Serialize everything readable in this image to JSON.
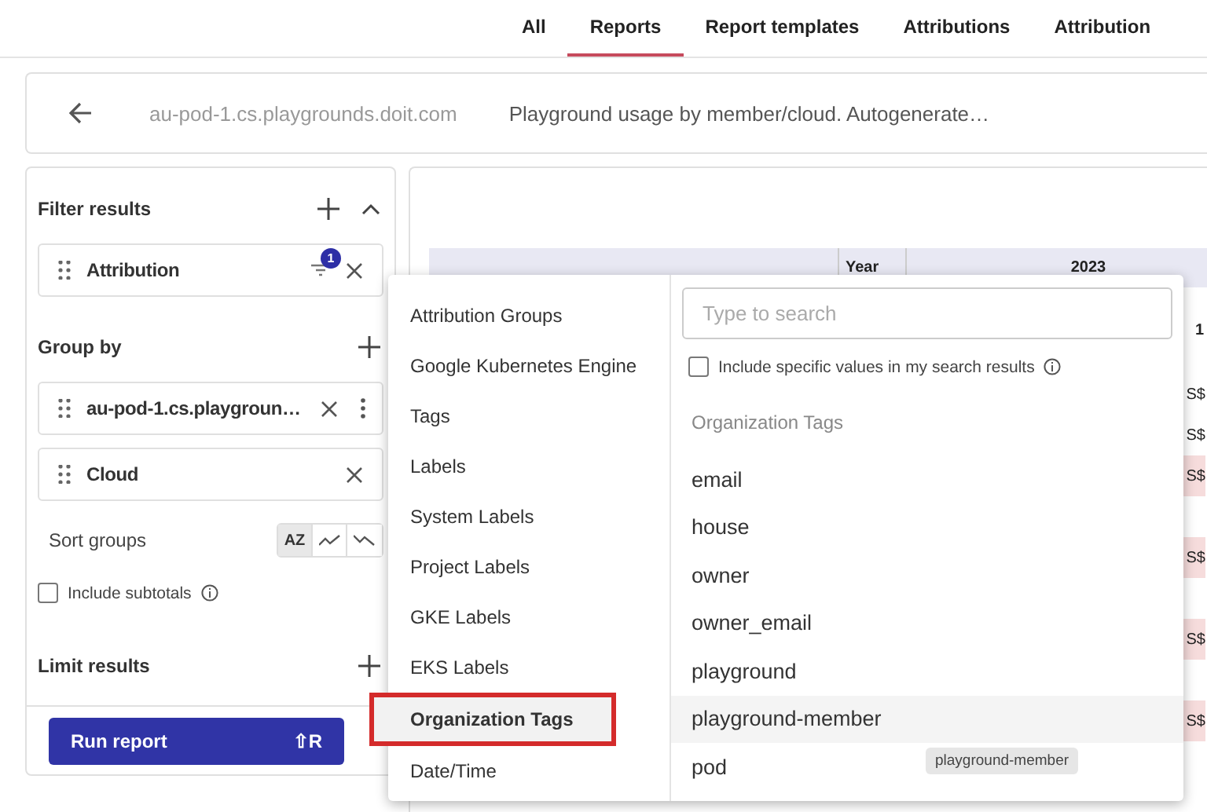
{
  "tabs": [
    {
      "label": "All",
      "selected": false
    },
    {
      "label": "Reports",
      "selected": true
    },
    {
      "label": "Report templates",
      "selected": false
    },
    {
      "label": "Attributions",
      "selected": false
    },
    {
      "label": "Attribution",
      "selected": false
    }
  ],
  "header": {
    "source": "au-pod-1.cs.playgrounds.doit.com",
    "title": "Playground usage by member/cloud. Autogenerate…"
  },
  "filter": {
    "title": "Filter results",
    "items": [
      {
        "label": "Attribution",
        "badge": "1"
      }
    ]
  },
  "group_by": {
    "title": "Group by",
    "items": [
      {
        "label": "au-pod-1.cs.playgroun…",
        "more": true
      },
      {
        "label": "Cloud",
        "more": false
      }
    ]
  },
  "sort": {
    "label": "Sort groups",
    "options": [
      {
        "kind": "text",
        "label": "AZ",
        "selected": true
      },
      {
        "kind": "trend-up",
        "selected": false
      },
      {
        "kind": "trend-down",
        "selected": false
      }
    ]
  },
  "subtotals": {
    "label": "Include subtotals",
    "checked": false
  },
  "limit": {
    "title": "Limit results"
  },
  "run": {
    "label": "Run report",
    "shortcut": "⇧R"
  },
  "table": {
    "year_label": "Year",
    "year": "2023",
    "column_3": "1",
    "cells": [
      {
        "text": "S$",
        "shaded": false
      },
      {
        "text": "S$",
        "shaded": false
      },
      {
        "text": "S$",
        "shaded": true
      },
      {
        "text": "S$",
        "shaded": true
      },
      {
        "text": "S$",
        "shaded": true
      },
      {
        "text": "S$",
        "shaded": true
      }
    ]
  },
  "menu": {
    "categories": [
      {
        "label": "Attribution Groups",
        "selected": false
      },
      {
        "label": "Google Kubernetes Engine",
        "selected": false
      },
      {
        "label": "Tags",
        "selected": false
      },
      {
        "label": "Labels",
        "selected": false
      },
      {
        "label": "System Labels",
        "selected": false
      },
      {
        "label": "Project Labels",
        "selected": false
      },
      {
        "label": "GKE Labels",
        "selected": false
      },
      {
        "label": "EKS Labels",
        "selected": false
      },
      {
        "label": "Organization Tags",
        "selected": true
      },
      {
        "label": "Date/Time",
        "selected": false
      }
    ],
    "search": {
      "placeholder": "Type to search"
    },
    "include": {
      "label": "Include specific values in my search results",
      "checked": false
    },
    "section": "Organization Tags",
    "options": [
      {
        "label": "email",
        "hovered": false
      },
      {
        "label": "house",
        "hovered": false
      },
      {
        "label": "owner",
        "hovered": false
      },
      {
        "label": "owner_email",
        "hovered": false
      },
      {
        "label": "playground",
        "hovered": false
      },
      {
        "label": "playground-member",
        "hovered": true
      },
      {
        "label": "pod",
        "hovered": false
      }
    ],
    "tooltip": "playground-member"
  }
}
